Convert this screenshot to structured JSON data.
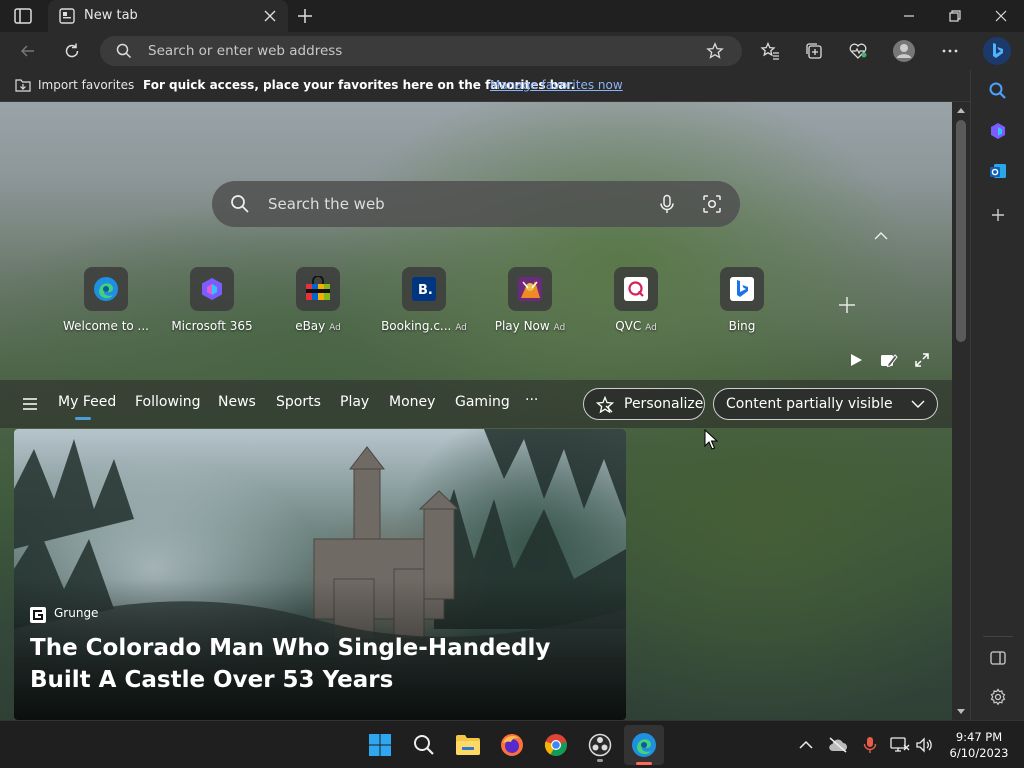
{
  "tab": {
    "title": "New tab"
  },
  "address_bar": {
    "placeholder": "Search or enter web address"
  },
  "favorites_bar": {
    "import_label": "Import favorites",
    "message": "For quick access, place your favorites here on the favorites bar.",
    "link": "Manage favorites now"
  },
  "page_search": {
    "placeholder": "Search the web"
  },
  "tiles": [
    {
      "label": "Welcome to ...",
      "ad": ""
    },
    {
      "label": "Microsoft 365",
      "ad": ""
    },
    {
      "label": "eBay",
      "ad": "Ad"
    },
    {
      "label": "Booking.c...",
      "ad": "Ad"
    },
    {
      "label": "Play Now",
      "ad": "Ad"
    },
    {
      "label": "QVC",
      "ad": "Ad"
    },
    {
      "label": "Bing",
      "ad": ""
    }
  ],
  "feed_nav": {
    "items": [
      "My Feed",
      "Following",
      "News",
      "Sports",
      "Play",
      "Money",
      "Gaming"
    ],
    "more": "···",
    "personalize": "Personalize",
    "visibility": "Content partially visible"
  },
  "article": {
    "source": "Grunge",
    "title": "The Colorado Man Who Single-Handedly Built A Castle Over 53 Years"
  },
  "taskbar": {
    "time": "9:47 PM",
    "date": "6/10/2023"
  },
  "colors": {
    "accent": "#4a9eda",
    "link": "#8ab4f8",
    "chrome": "#2b2b2b"
  }
}
